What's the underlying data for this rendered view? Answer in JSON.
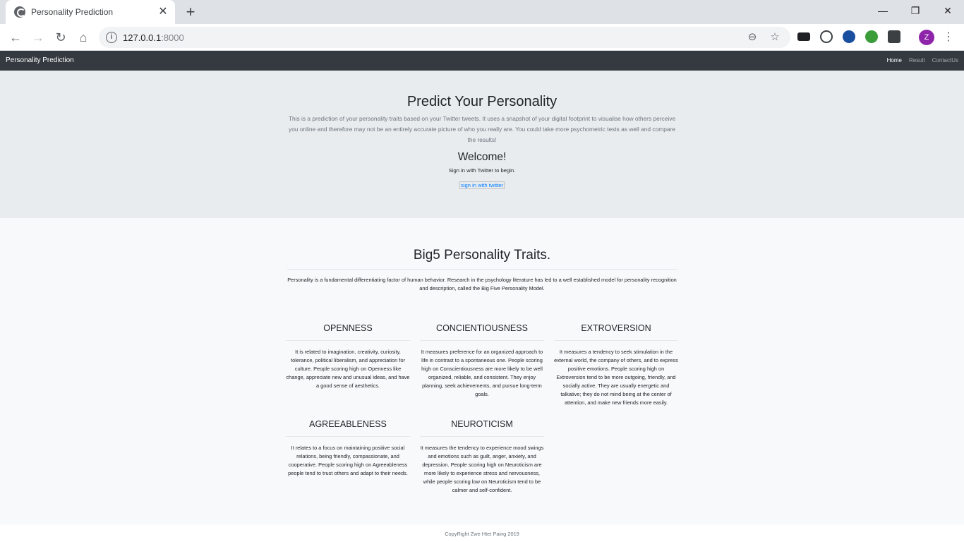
{
  "browser": {
    "tab_title": "Personality Prediction",
    "tab_close": "✕",
    "new_tab": "+",
    "url_host": "127.0.0.1",
    "url_port": ":8000",
    "profile_initial": "Z",
    "window_controls": {
      "minimize": "—",
      "restore": "❐",
      "close": "✕"
    },
    "nav": {
      "back": "←",
      "forward": "→",
      "reload": "↻",
      "home": "⌂"
    },
    "omnibox_info": "i",
    "zoom_icon": "⊖",
    "bookmark_icon": "☆",
    "menu": "⋮"
  },
  "navbar": {
    "brand": "Personality Prediction",
    "links": [
      "Home",
      "Result",
      "ContactUs"
    ]
  },
  "hero": {
    "title": "Predict Your Personality",
    "lead": "This is a prediction of your personality traits based on your Twitter tweets. It uses a snapshot of your digital footprint to visualise how others perceive you online and therefore may not be an entirely accurate picture of who you really are. You could take more psychometric tests as well and compare the results!",
    "welcome": "Welcome!",
    "signin_text": "Sign in with Twitter to begin.",
    "signin_alt": "sign in with twitter"
  },
  "big5": {
    "title": "Big5 Personality Traits.",
    "intro": "Personality is a fundamental differentiating factor of human behavior. Research in the psychology literature has led to a well established model for personality recognition and description, called the Big Five Personality Model.",
    "traits": [
      {
        "name": "OPENNESS",
        "description": "It is related to imagination, creativity, curiosity, tolerance, political liberalism, and appreciation for culture. People scoring high on Openness like change, appreciate new and unusual ideas, and have a good sense of aesthetics."
      },
      {
        "name": "CONCIENTIOUSNESS",
        "description": "It measures preference for an organized approach to life in contrast to a spontaneous one. People scoring high on Conscientiousness are more likely to be well organized, reliable, and consistent. They enjoy planning, seek achievements, and pursue long-term goals."
      },
      {
        "name": "EXTROVERSION",
        "description": "It measures a tendency to seek stimulation in the external world, the company of others, and to express positive emotions. People scoring high on Extroversion tend to be more outgoing, friendly, and socially active. They are usually energetic and talkative; they do not mind being at the center of attention, and make new friends more easily."
      },
      {
        "name": "AGREEABLENESS",
        "description": "It relates to a focus on maintaining positive social relations, being friendly, compassionate, and cooperative. People scoring high on Agreeableness people tend to trust others and adapt to their needs."
      },
      {
        "name": "NEUROTICISM",
        "description": "It measures the tendency to experience mood swings and emotions such as guilt, anger, anxiety, and depression. People scoring high on Neuroticism are more likely to experience stress and nervousness, while people scoring low on Neuroticism tend to be calmer and self-confident."
      }
    ]
  },
  "footer": {
    "copyright": "CopyRight Zwe Htet Paing 2019"
  }
}
